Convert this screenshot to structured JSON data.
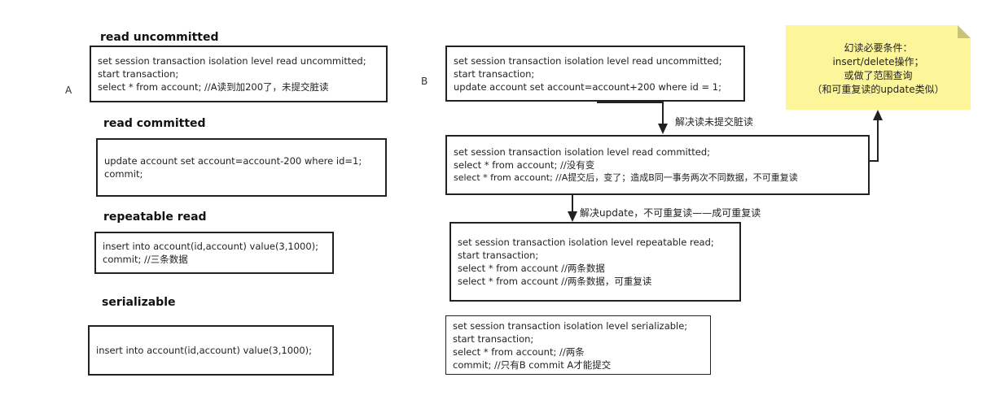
{
  "side_labels": {
    "a": "A",
    "b": "B"
  },
  "headings": {
    "read_uncommitted": "read uncommitted",
    "read_committed": "read committed",
    "repeatable_read": "repeatable read",
    "serializable": "serializable"
  },
  "left_boxes": {
    "read_uncommitted": [
      "set session transaction isolation level read uncommitted;",
      "start transaction;",
      "select * from account;      //A读到加200了，未提交脏读"
    ],
    "read_committed": [
      "update account set account=account-200 where id=1;",
      "commit;"
    ],
    "repeatable_read": [
      "insert into account(id,account) value(3,1000);",
      "commit; //三条数据"
    ],
    "serializable": [
      "insert into account(id,account) value(3,1000);"
    ]
  },
  "right_boxes": {
    "read_uncommitted": [
      "set session transaction isolation level read uncommitted;",
      "start transaction;",
      "update account set account=account+200 where id = 1;"
    ],
    "read_committed": [
      "set session transaction isolation level read committed;",
      "select * from account; //没有变",
      "select * from account; //A提交后，变了；造成B同一事务两次不同数据，不可重复读"
    ],
    "repeatable_read": [
      "set session transaction isolation level repeatable read;",
      "start transaction;",
      "select * from account //两条数据",
      "select * from account //两条数据，可重复读"
    ],
    "serializable": [
      "set session transaction isolation level serializable;",
      "start transaction;",
      "select * from account; //两条",
      "commit; //只有B commit A才能提交"
    ]
  },
  "edge_labels": {
    "dirty_read_solved": "解决读未提交脏读",
    "non_repeatable_solved": "解决update，不可重复读——成可重复读"
  },
  "note": {
    "lines": [
      "幻读必要条件：",
      "insert/delete操作；",
      "或做了范围查询",
      "（和可重复读的update类似）"
    ],
    "color": "#fdf59a"
  }
}
